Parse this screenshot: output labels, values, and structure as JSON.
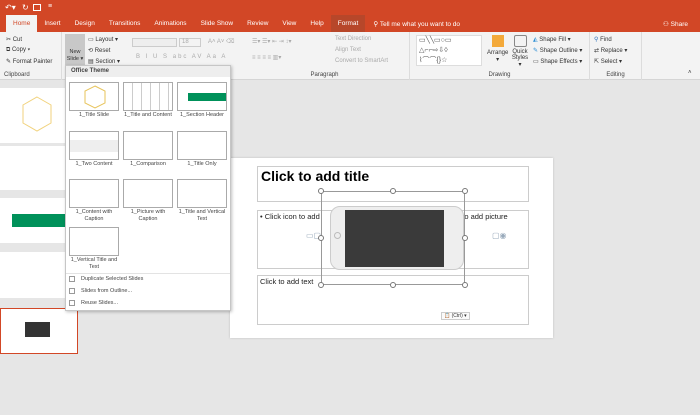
{
  "quick_access": {
    "undo": "undo-icon",
    "redo": "redo-icon"
  },
  "tabs": [
    "Home",
    "Insert",
    "Design",
    "Transitions",
    "Animations",
    "Slide Show",
    "Review",
    "View",
    "Help",
    "Format"
  ],
  "tell_me": "Tell me what you want to do",
  "share": "Share",
  "clipboard": {
    "cut": "Cut",
    "copy": "Copy",
    "format_painter": "Format Painter",
    "label": "Clipboard"
  },
  "slides": {
    "new_slide": "New Slide",
    "layout": "Layout",
    "reset": "Reset",
    "section": "Section"
  },
  "paragraph": {
    "label": "Paragraph",
    "text_direction": "Text Direction",
    "align_text": "Align Text",
    "convert": "Convert to SmartArt"
  },
  "drawing": {
    "label": "Drawing",
    "arrange": "Arrange",
    "quick_styles": "Quick Styles",
    "shape_fill": "Shape Fill",
    "shape_outline": "Shape Outline",
    "shape_effects": "Shape Effects"
  },
  "editing": {
    "label": "Editing",
    "find": "Find",
    "replace": "Replace",
    "select": "Select"
  },
  "font": {
    "size": "18",
    "styles": [
      "B",
      "I",
      "U",
      "S",
      "abc",
      "AV",
      "Aa",
      "A"
    ]
  },
  "menu": {
    "header": "Office Theme",
    "layouts": [
      "1_Title Slide",
      "1_Title and Content",
      "1_Section Header",
      "1_Two Content",
      "1_Comparison",
      "1_Title Only",
      "1_Content with Caption",
      "1_Picture with Caption",
      "1_Title and Vertical Text",
      "1_Vertical Title and Text"
    ],
    "items": [
      "Duplicate Selected Slides",
      "Slides from Outline...",
      "Reuse Slides..."
    ]
  },
  "slide": {
    "title": "Click to add title",
    "content_left": "• Click icon to add",
    "content_right": "n to add picture",
    "text": "Click to add text",
    "paste_options": "(Ctrl)"
  },
  "colors": {
    "accent": "#d24726",
    "green": "#00915a"
  }
}
